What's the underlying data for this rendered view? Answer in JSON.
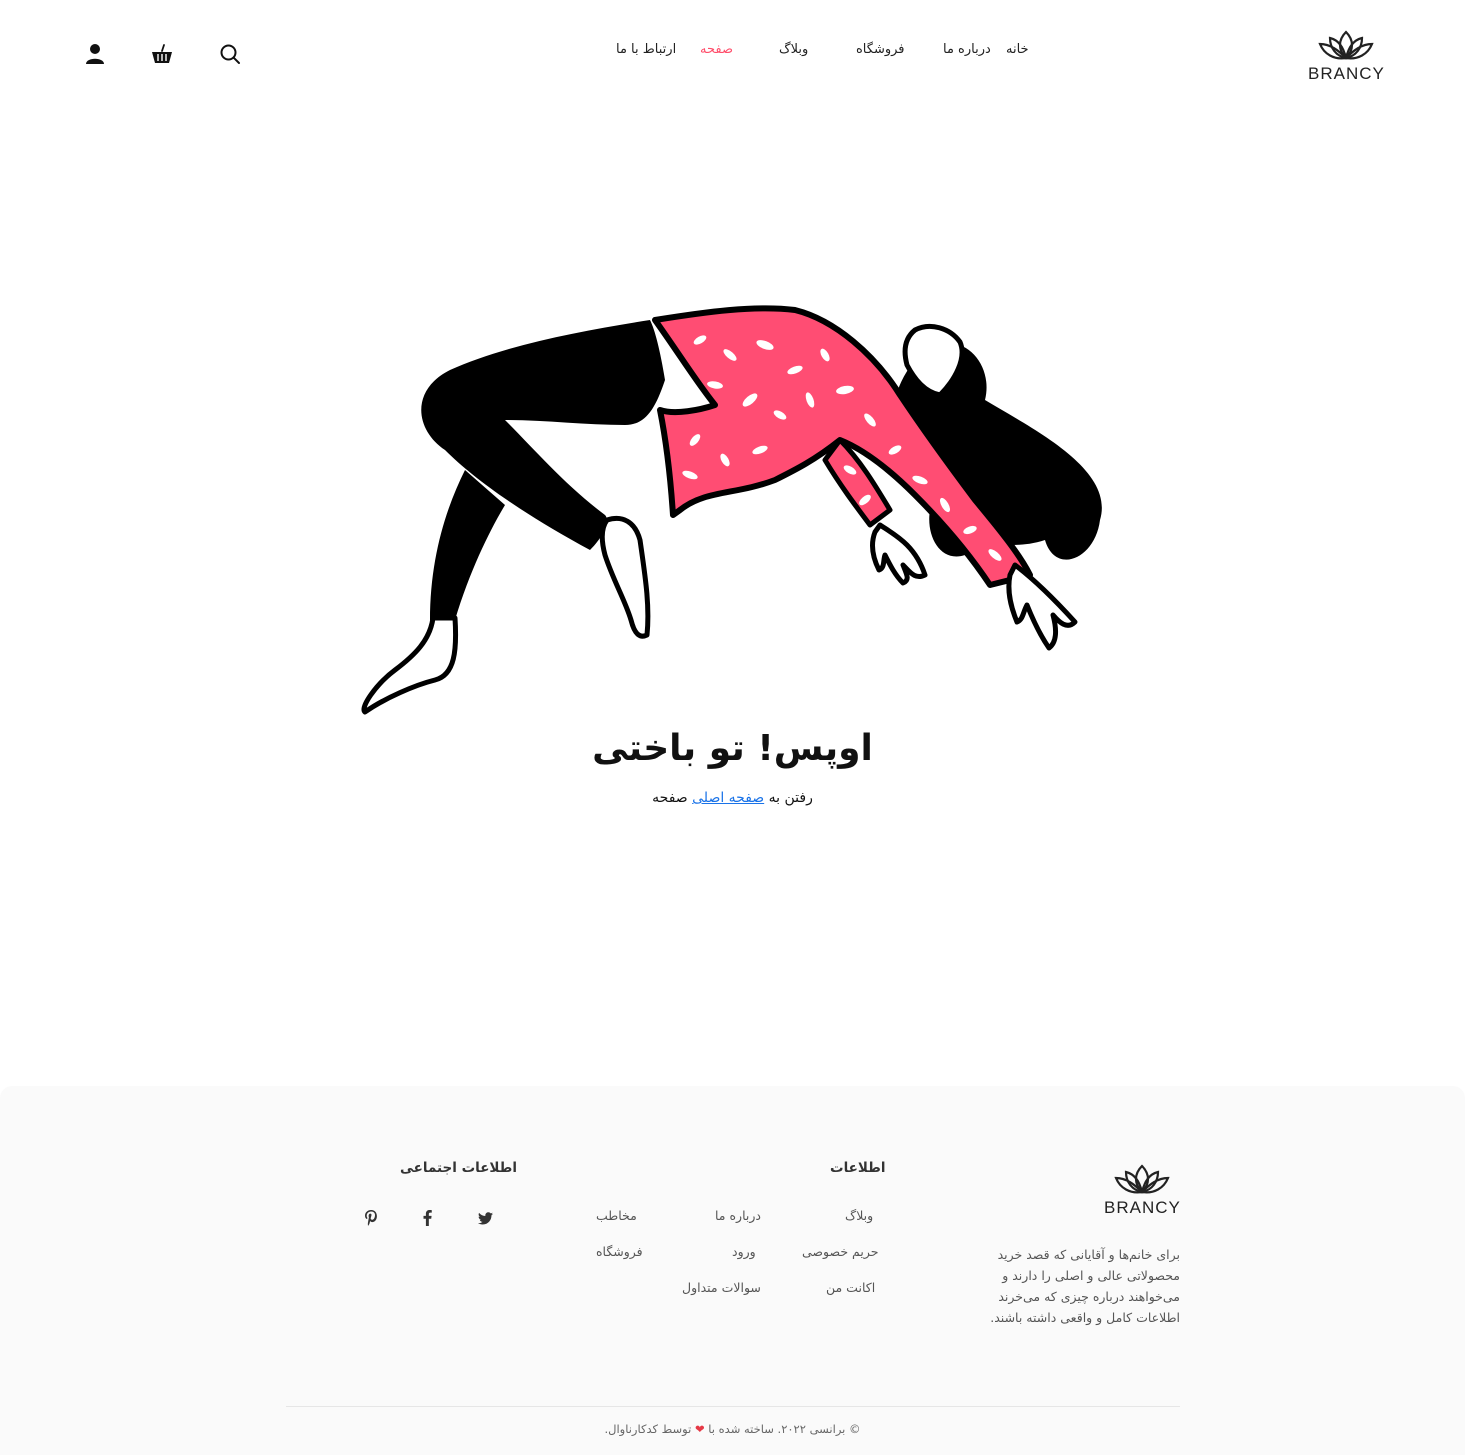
{
  "header": {
    "logo_text": "BRANCY",
    "nav": [
      {
        "label": "خانه",
        "active": false
      },
      {
        "label": "درباره ما",
        "active": false
      },
      {
        "label": "فروشگاه",
        "active": false
      },
      {
        "label": "وبلاگ",
        "active": false
      },
      {
        "label": "صفحه",
        "active": true
      },
      {
        "label": "ارتباط با ما",
        "active": false
      }
    ],
    "icons": [
      "search-icon",
      "basket-icon",
      "user-icon"
    ]
  },
  "main": {
    "title": "اوپس! تو باختی",
    "subtitle_prefix": "رفتن به",
    "subtitle_link": "صفحه اصلی",
    "subtitle_suffix": "صفحه"
  },
  "footer": {
    "logo_text": "BRANCY",
    "about": "برای خانم‌ها و آقایانی که قصد خرید محصولاتی عالی و اصلی را دارند و می‌خواهند درباره چیزی که می‌خرند اطلاعات کامل و واقعی داشته باشند.",
    "info_heading": "اطلاعات",
    "info_col1": [
      "وبلاگ",
      "حریم خصوصی",
      "اکانت من"
    ],
    "info_col2": [
      "درباره ما",
      "ورود",
      "سوالات متداول"
    ],
    "info_col3": [
      "مخاطب",
      "فروشگاه"
    ],
    "social_heading": "اطلاعات اجتماعی",
    "social_icons": [
      "twitter-icon",
      "facebook-icon",
      "pinterest-icon"
    ],
    "copyright_prefix": "© برانسی ۲۰۲۲. ساخته شده با",
    "copyright_suffix": "توسط کدکارناوال."
  },
  "colors": {
    "accent": "#ff4d6a",
    "link": "#1a73e8",
    "footer_bg": "#fafafa",
    "heart": "#e53946"
  }
}
